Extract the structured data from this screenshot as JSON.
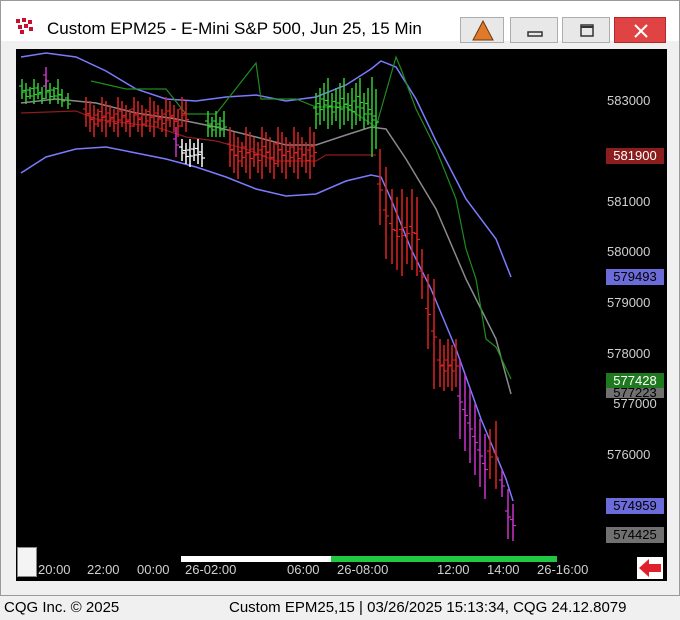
{
  "window": {
    "title": "Custom EPM25 - E-Mini S&P 500, Jun 25, 15 Min"
  },
  "price_axis": {
    "labels": [
      "583000",
      "581000",
      "580000",
      "579000",
      "578000",
      "576000"
    ],
    "badges": [
      {
        "value": "581900",
        "bg": "#8c1d1d",
        "fg": "#ffffff"
      },
      {
        "value": "579493",
        "bg": "#6b6bd9",
        "fg": "#000000"
      },
      {
        "value": "577428",
        "bg": "#1f7a1f",
        "fg": "#ffffff"
      },
      {
        "value": "577223",
        "bg": "#707070",
        "fg": "#000000"
      },
      {
        "value": "577000",
        "bg": "#000000",
        "fg": "#d0d0d0"
      },
      {
        "value": "574959",
        "bg": "#6b6bd9",
        "fg": "#000000"
      },
      {
        "value": "574425",
        "bg": "#707070",
        "fg": "#000000"
      }
    ]
  },
  "time_axis": {
    "labels": [
      "20:00",
      "22:00",
      "00:00",
      "26-02:00",
      "06:00",
      "26-08:00",
      "12:00",
      "14:00",
      "26-16:00"
    ]
  },
  "status": {
    "left": "CQG Inc. © 2025",
    "right": "Custom EPM25,15 | 03/26/2025 15:13:34, CQG 24.12.8079"
  },
  "colors": {
    "up": "#33cc33",
    "down": "#dd2222",
    "neutral": "#ffffff",
    "magenta": "#cc33cc",
    "bands": "#7b7bff",
    "mid": "#8a8a8a",
    "sar_green": "#1e8c1e",
    "sar_red": "#8c1d1d"
  }
}
